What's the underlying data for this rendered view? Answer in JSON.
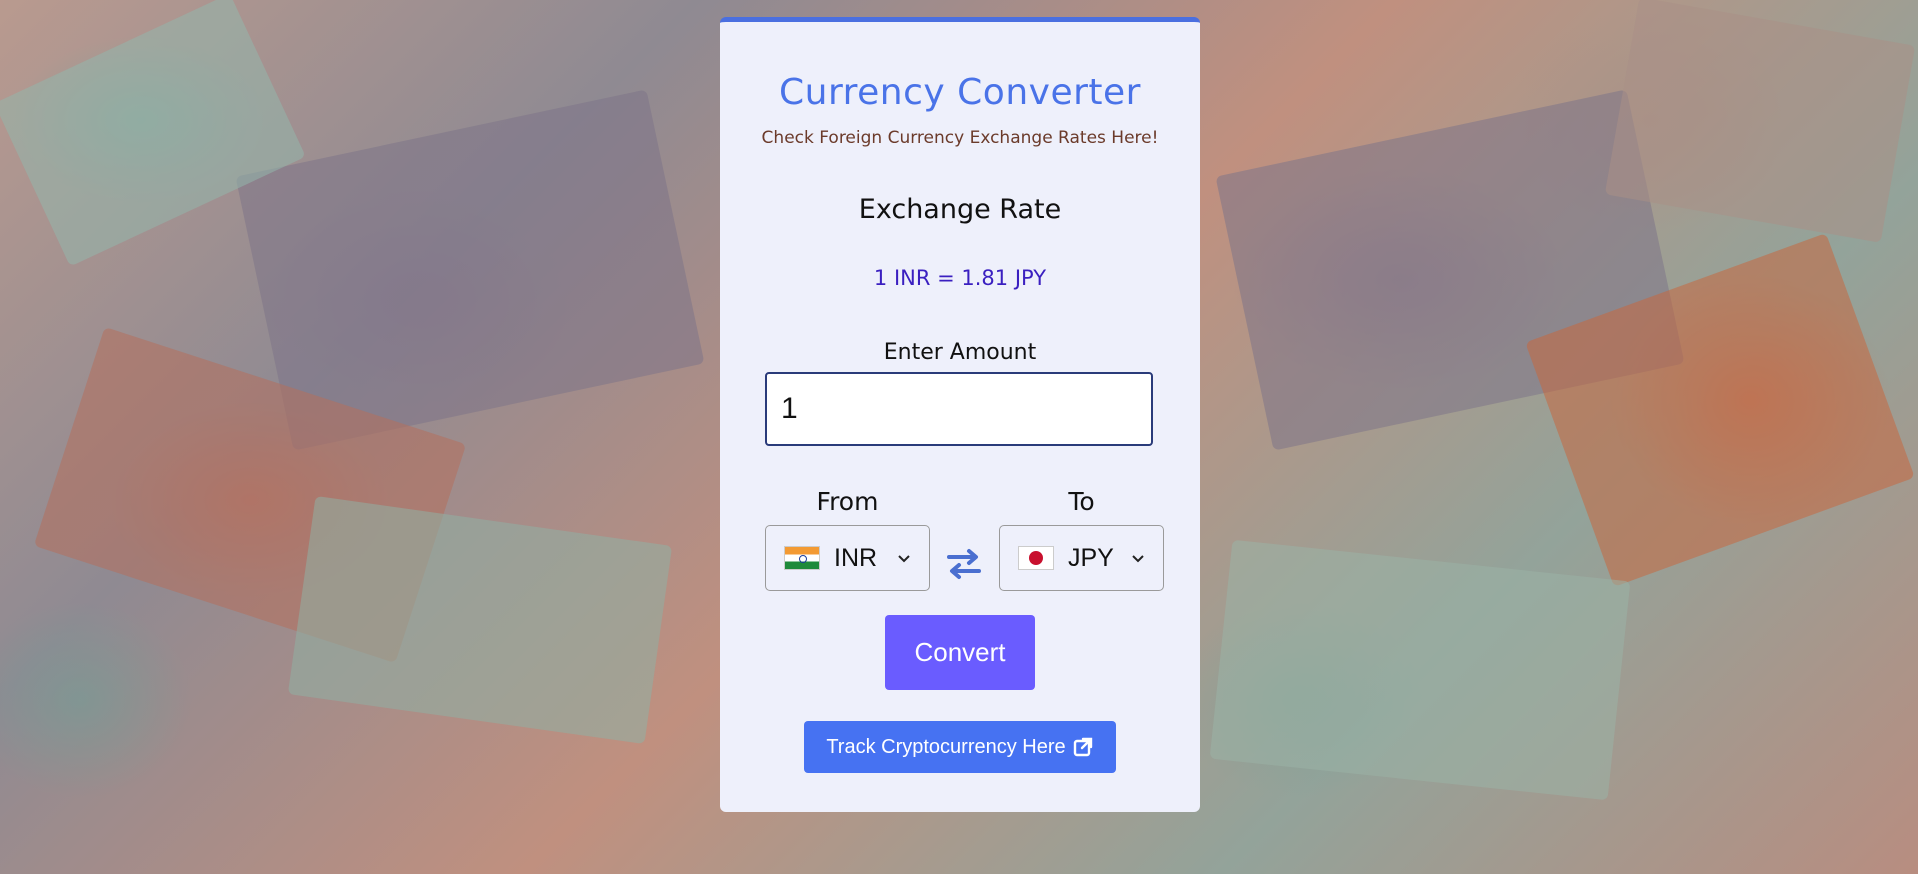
{
  "background": {
    "description_icon": "banknotes-background"
  },
  "header": {
    "title": "Currency Converter",
    "subtitle": "Check Foreign Currency Exchange Rates Here!"
  },
  "exchange_rate": {
    "heading": "Exchange Rate",
    "value": "1 INR = 1.81 JPY"
  },
  "amount": {
    "label": "Enter Amount",
    "value": "1"
  },
  "from": {
    "label": "From",
    "currency": "INR",
    "flag_icon": "india-flag-icon"
  },
  "to": {
    "label": "To",
    "currency": "JPY",
    "flag_icon": "japan-flag-icon"
  },
  "buttons": {
    "convert": "Convert",
    "crypto": "Track Cryptocurrency Here"
  },
  "colors": {
    "accent": "#4a73e8",
    "convert_button": "#6a5cff",
    "crypto_button": "#4672f2",
    "rate_text": "#3a1fc0"
  }
}
